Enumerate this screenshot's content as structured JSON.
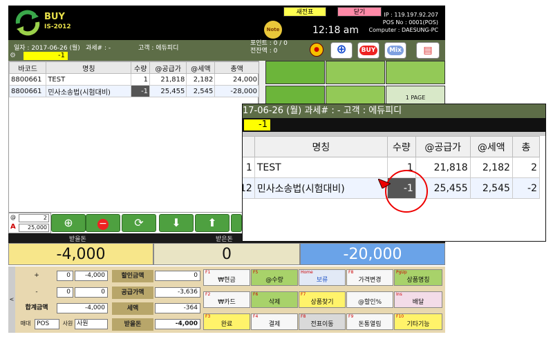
{
  "header": {
    "brand_top": "BUY",
    "brand_bottom": "IS-2012",
    "new_ticket": "새전표",
    "close": "닫기",
    "note": "Note",
    "time": "12:18 am",
    "ip": "IP : 119.197.92.207",
    "pos_no": "POS No : 0001(POS)",
    "computer": "Computer : DAESUNG-PC"
  },
  "status": {
    "date": "일자 : 2017-06-26 (월)",
    "tax": "과세# : -",
    "customer": "고객 : 에듀피디",
    "points": "포인트 : 0 / 0",
    "balance": "전잔액 : 0",
    "scan_value": "-1",
    "buy_label": "BUY",
    "mix_label": "Mix"
  },
  "table": {
    "headers": [
      "바코드",
      "명칭",
      "수량",
      "@공급가",
      "@세액",
      "총액"
    ],
    "rows": [
      {
        "barcode": "8800661",
        "name": "TEST",
        "qty": "1",
        "supply": "21,818",
        "tax": "2,182",
        "total": "24,000"
      },
      {
        "barcode": "8800661",
        "name": "민사소송법(시험대비)",
        "qty": "-1",
        "supply": "25,455",
        "tax": "2,545",
        "total": "-28,000"
      }
    ]
  },
  "tiles": {
    "page_label": "1 PAGE"
  },
  "qtybox": {
    "top": "2",
    "bottom": "25,000",
    "at": "@",
    "a": "A"
  },
  "amounts": {
    "paid_label": "받을돈",
    "received_label": "받은돈",
    "paid": "-4,000",
    "received": "0",
    "change": "-20,000"
  },
  "bottom": {
    "plus": "+",
    "minus": "-",
    "plus_qty": "0",
    "plus_amt": "-4,000",
    "minus_qty": "0",
    "minus_amt": "0",
    "total_label": "합계금액",
    "total_val": "-4,000",
    "sale_type": "매대",
    "pos": "POS",
    "staff_label": "사원",
    "staff_val": "사원",
    "discount_label": "할인금액",
    "discount_val": "0",
    "supply_label": "공급가액",
    "supply_val": "-3,636",
    "tax_label": "세액",
    "tax_val": "-364",
    "pay_label": "받을돈",
    "pay_val": "-4,000"
  },
  "fkeys": [
    {
      "key": "F1",
      "label": "₩현금"
    },
    {
      "key": "F5",
      "label": "@수량"
    },
    {
      "key": "Home",
      "label": "보류"
    },
    {
      "key": "F8",
      "label": "가격변경"
    },
    {
      "key": "PgUp",
      "label": "상품명칭"
    },
    {
      "key": "F2",
      "label": "₩카드"
    },
    {
      "key": "F6",
      "label": "삭제"
    },
    {
      "key": "F7",
      "label": "상품찾기"
    },
    {
      "key": "",
      "label": "@할인%"
    },
    {
      "key": "Ins",
      "label": "배달"
    },
    {
      "key": "F3",
      "label": "완료"
    },
    {
      "key": "F4",
      "label": "결제"
    },
    {
      "key": "F8",
      "label": "전표이동"
    },
    {
      "key": "F9",
      "label": "돈통열림"
    },
    {
      "key": "F10",
      "label": "기타기능"
    }
  ],
  "zoom": {
    "bar": "17-06-26 (월)     과세# :  -            고객 : 에듀피디",
    "scan_value": "-1",
    "headers": [
      "",
      "명칭",
      "수량",
      "@공급가",
      "@세액",
      "총"
    ],
    "rows": [
      {
        "id": "1",
        "name": "TEST",
        "qty": "1",
        "supply": "21,818",
        "tax": "2,182",
        "total": "2"
      },
      {
        "id": "12",
        "name": "민사소송법(시험대비)",
        "qty": "-1",
        "supply": "25,455",
        "tax": "2,545",
        "total": "-2"
      }
    ]
  },
  "colors": {
    "accent": "#5d6d47",
    "highlight": "#e00000"
  }
}
